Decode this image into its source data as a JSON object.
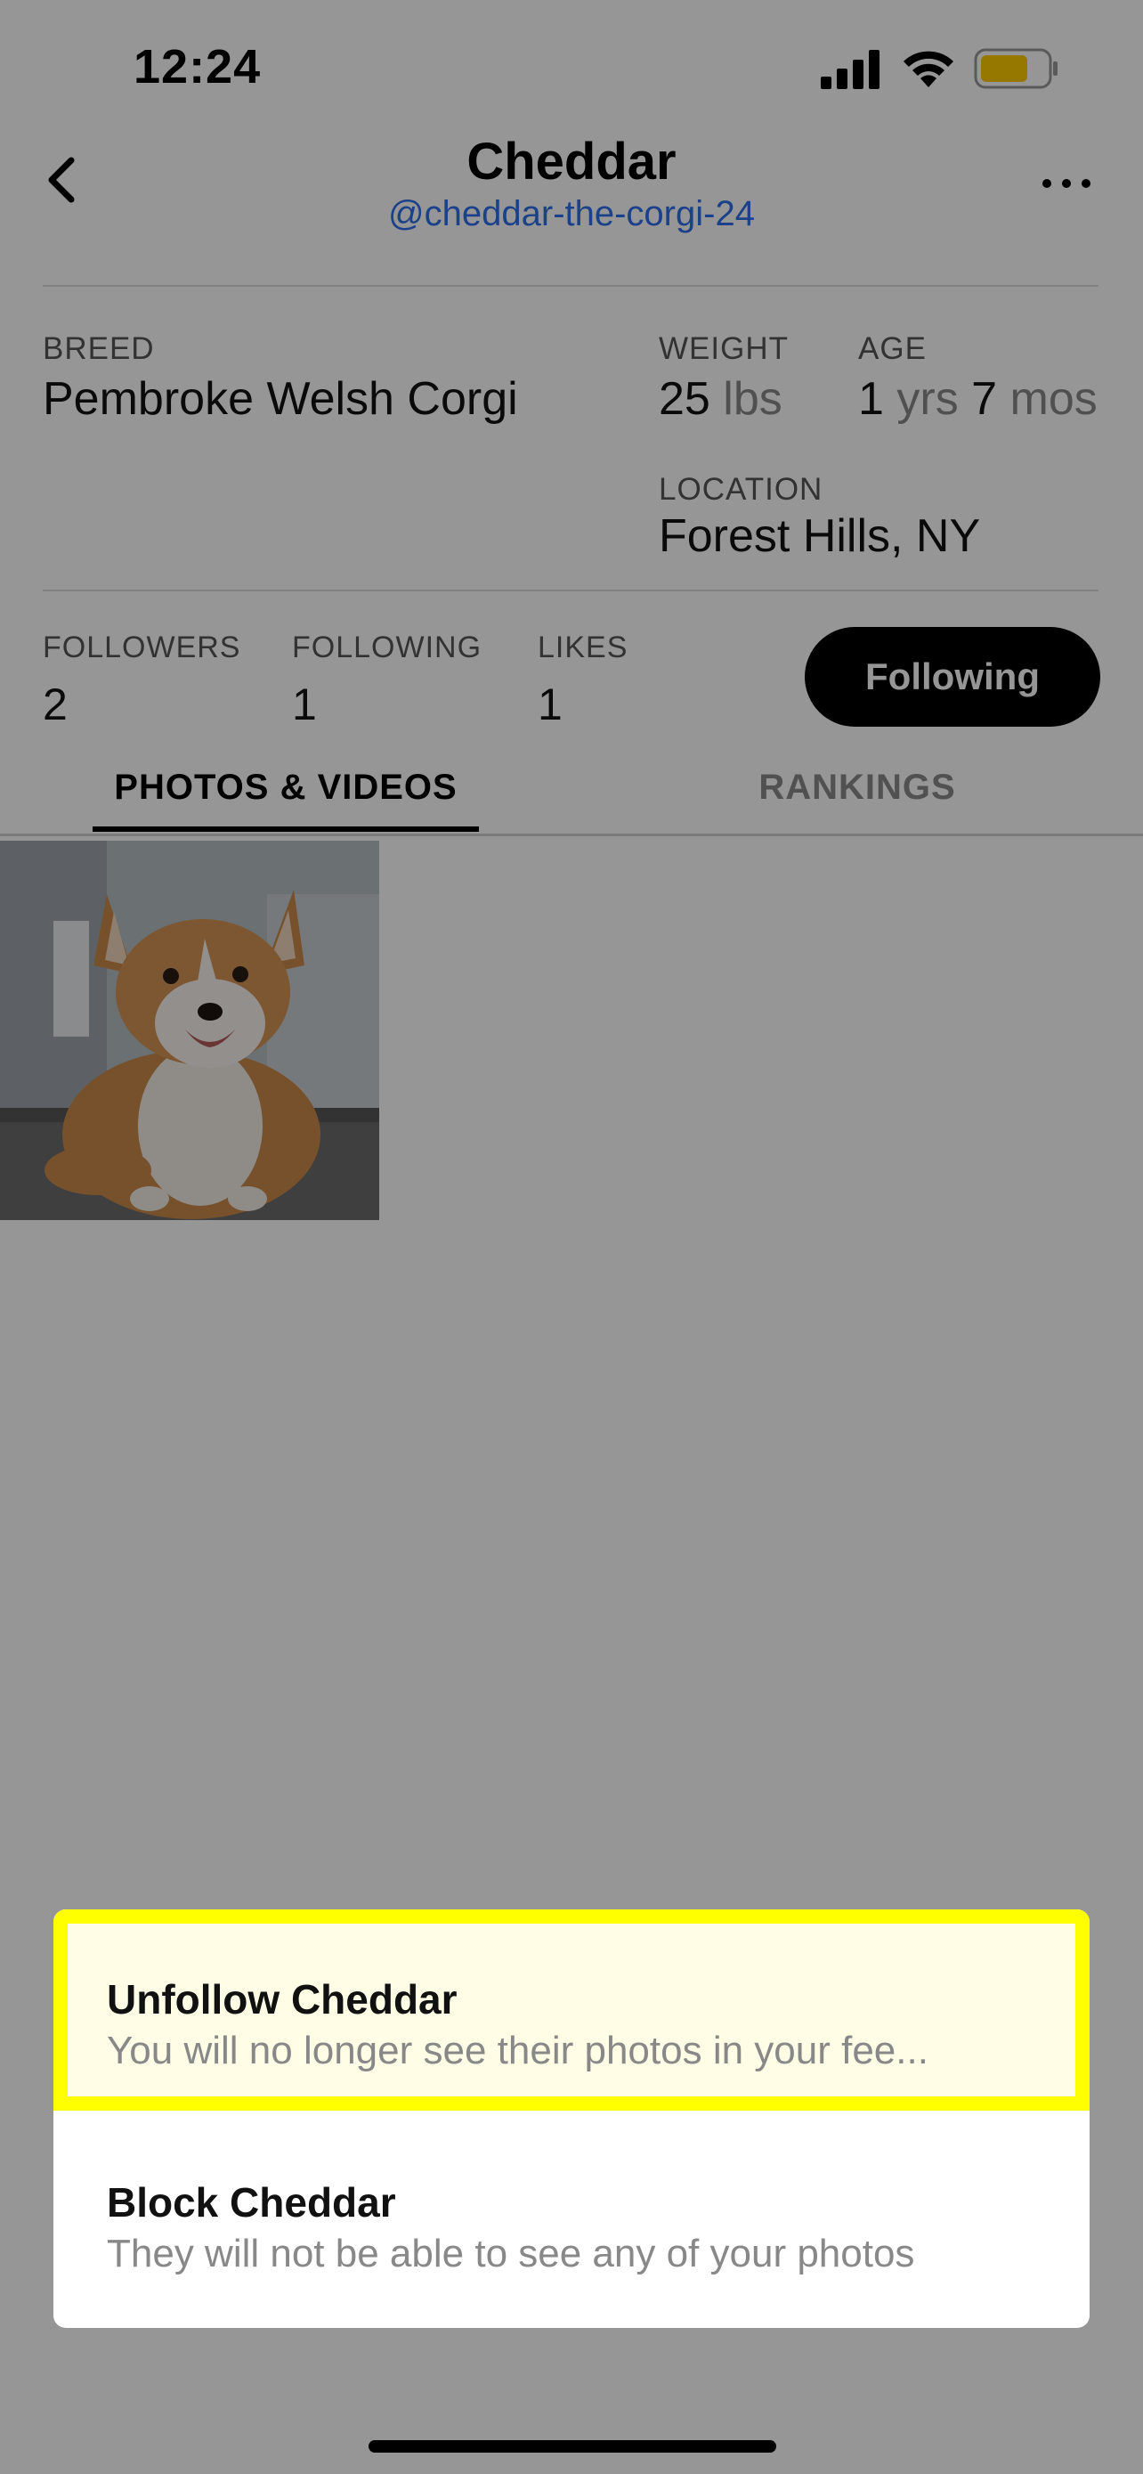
{
  "status_bar": {
    "time": "12:24",
    "signal_icon": "cellular-signal-icon",
    "wifi_icon": "wifi-icon",
    "battery_icon": "battery-icon",
    "battery_color": "#ffcc00"
  },
  "header": {
    "back_icon": "chevron-left-icon",
    "title": "Cheddar",
    "handle": "@cheddar-the-corgi-24",
    "more_icon": "ellipsis-icon"
  },
  "profile": {
    "breed_label": "BREED",
    "breed_value": "Pembroke Welsh Corgi",
    "weight_label": "WEIGHT",
    "weight_number": "25",
    "weight_unit": "lbs",
    "age_label": "AGE",
    "age_years_number": "1",
    "age_years_unit": "yrs",
    "age_months_number": "7",
    "age_months_unit": "mos",
    "location_label": "LOCATION",
    "location_value": "Forest Hills, NY"
  },
  "stats": {
    "followers_label": "FOLLOWERS",
    "followers_value": "2",
    "following_label": "FOLLOWING",
    "following_value": "1",
    "likes_label": "LIKES",
    "likes_value": "1",
    "follow_button_label": "Following"
  },
  "tabs": {
    "active": "PHOTOS & VIDEOS",
    "inactive": "RANKINGS"
  },
  "action_sheet": {
    "unfollow_title": "Unfollow Cheddar",
    "unfollow_subtitle": "You will no longer see their photos in your fee...",
    "block_title": "Block Cheddar",
    "block_subtitle": "They will not be able to see any of your photos",
    "highlight_color": "#ffff00"
  }
}
